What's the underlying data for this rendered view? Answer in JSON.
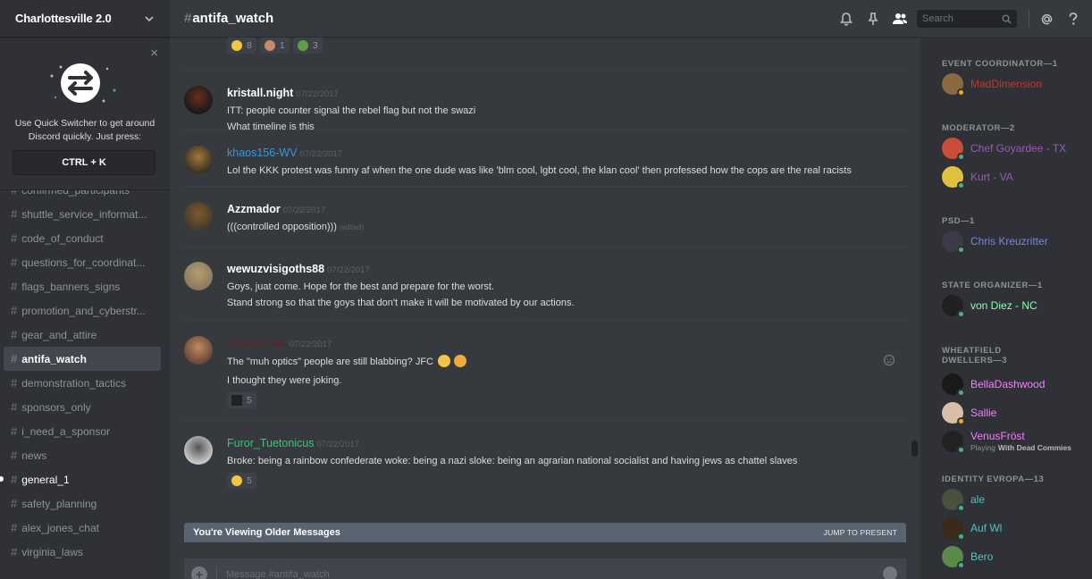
{
  "server": {
    "name": "Charlottesville 2.0"
  },
  "quick_switcher": {
    "text": "Use Quick Switcher to get around Discord quickly. Just press:",
    "shortcut": "CTRL + K",
    "close": "×"
  },
  "channels": [
    {
      "name": "confirmed_participants",
      "state": "normal"
    },
    {
      "name": "shuttle_service_informat...",
      "state": "normal"
    },
    {
      "name": "code_of_conduct",
      "state": "normal"
    },
    {
      "name": "questions_for_coordinat...",
      "state": "normal"
    },
    {
      "name": "flags_banners_signs",
      "state": "normal"
    },
    {
      "name": "promotion_and_cyberstr...",
      "state": "normal"
    },
    {
      "name": "gear_and_attire",
      "state": "normal"
    },
    {
      "name": "antifa_watch",
      "state": "active"
    },
    {
      "name": "demonstration_tactics",
      "state": "normal"
    },
    {
      "name": "sponsors_only",
      "state": "normal"
    },
    {
      "name": "i_need_a_sponsor",
      "state": "normal"
    },
    {
      "name": "news",
      "state": "normal"
    },
    {
      "name": "general_1",
      "state": "unread"
    },
    {
      "name": "safety_planning",
      "state": "normal"
    },
    {
      "name": "alex_jones_chat",
      "state": "normal"
    },
    {
      "name": "virginia_laws",
      "state": "normal"
    }
  ],
  "header": {
    "hash": "#",
    "channel": "antifa_watch",
    "search_placeholder": "Search"
  },
  "top_reactions": [
    {
      "emoji": "joy",
      "count": "8",
      "color": "#f4c542"
    },
    {
      "emoji": "face",
      "count": "1",
      "color": "#c98a6b"
    },
    {
      "emoji": "frog",
      "count": "3",
      "color": "#5f9e43"
    }
  ],
  "messages": [
    {
      "author": "kristall.night",
      "color": "#ffffff",
      "timestamp": "07/22/2017",
      "lines": [
        "ITT: people counter signal the rebel flag but not the swazi",
        "What timeline is this"
      ]
    },
    {
      "author": "khaos156-WV",
      "color": "#3498db",
      "timestamp": "07/22/2017",
      "lines": [
        "Lol the KKK protest was funny af when the one dude was like 'blm cool, lgbt cool, the klan cool' then professed how the cops are the real racists"
      ]
    },
    {
      "author": "Azzmador",
      "color": "#ffffff",
      "timestamp": "07/22/2017",
      "lines": [
        "(((controlled opposition)))"
      ],
      "edited": "(edited)"
    },
    {
      "author": "wewuzvisigoths88",
      "color": "#ffffff",
      "timestamp": "07/22/2017",
      "lines": [
        "Goys, juat come. Hope for the best and prepare for the worst.",
        "Stand strong so that the goys that don't make it will be motivated by our actions."
      ]
    },
    {
      "author": "Gusty-Chan",
      "color": "#6b1f1f",
      "timestamp": "07/22/2017",
      "lines": [
        "The \"muh optics\" people are still blabbing? JFC",
        "I thought they were joking."
      ],
      "reaction": {
        "emoji": "this-bit",
        "count": "5"
      }
    },
    {
      "author": "Furor_Tuetonicus",
      "color": "#2ecc71",
      "timestamp": "07/22/2017",
      "lines": [
        "Broke: being a rainbow confederate woke: being a nazi sloke: being an agrarian national socialist and having jews as chattel slaves"
      ],
      "reaction": {
        "emoji": "ok-hand",
        "count": "5"
      }
    }
  ],
  "older_bar": {
    "left": "You're Viewing Older Messages",
    "right": "JUMP TO PRESENT"
  },
  "input": {
    "placeholder": "Message #antifa_watch"
  },
  "members": {
    "roles": [
      {
        "title": "EVENT COORDINATOR—1",
        "members": [
          {
            "name": "MadDimension",
            "color": "#c0392b",
            "status": "#faa61a"
          }
        ]
      },
      {
        "title": "MODERATOR—2",
        "members": [
          {
            "name": "Chef Goyardee - TX",
            "color": "#9b59b6",
            "status": "#43b581"
          },
          {
            "name": "Kurt - VA",
            "color": "#9b59b6",
            "status": "#43b581"
          }
        ]
      },
      {
        "title": "PSD—1",
        "members": [
          {
            "name": "Chris Kreuzritter",
            "color": "#7289da",
            "status": "#43b581"
          }
        ]
      },
      {
        "title": "STATE ORGANIZER—1",
        "members": [
          {
            "name": "von Diez - NC",
            "color": "#8cffb0",
            "status": "#43b581"
          }
        ]
      },
      {
        "title": "WHEATFIELD DWELLERS—3",
        "members": [
          {
            "name": "BellaDashwood",
            "color": "#f47fff",
            "status": "#43b581"
          },
          {
            "name": "Sallie",
            "color": "#f47fff",
            "status": "#faa61a"
          },
          {
            "name": "VenusFröst",
            "color": "#f47fff",
            "status": "#43b581",
            "game_prefix": "Playing",
            "game": "With Dead Commies"
          }
        ]
      },
      {
        "title": "IDENTITY EVROPA—13",
        "members": [
          {
            "name": "ale",
            "color": "#4fc3c8",
            "status": "#43b581"
          },
          {
            "name": "Auf Wl",
            "color": "#4fc3c8",
            "status": "#43b581"
          },
          {
            "name": "Bero",
            "color": "#4fc3c8",
            "status": "#43b581"
          }
        ]
      }
    ]
  }
}
